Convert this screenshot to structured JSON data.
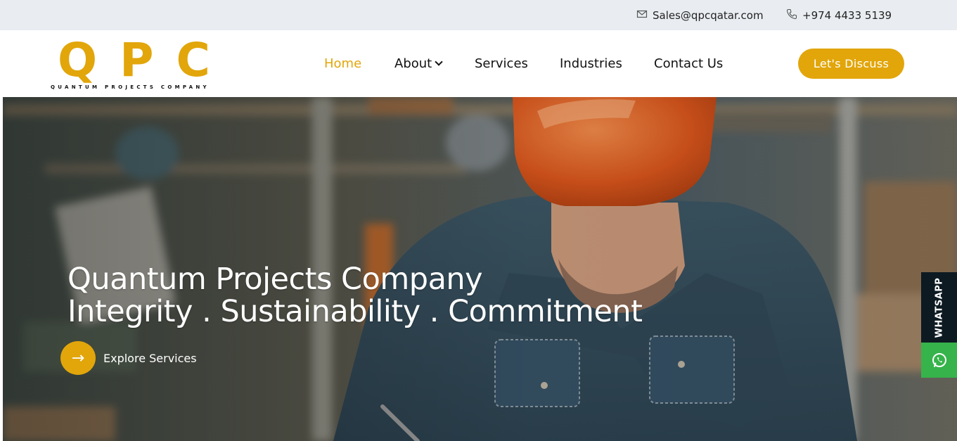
{
  "topbar": {
    "email": "Sales@qpcqatar.com",
    "phone": "+974 4433 5139",
    "email_icon": "envelope-icon",
    "phone_icon": "phone-icon"
  },
  "logo": {
    "letters": [
      "Q",
      "P",
      "C"
    ],
    "subtitle": "QUANTUM PROJECTS COMPANY"
  },
  "nav": {
    "items": [
      {
        "label": "Home",
        "active": true
      },
      {
        "label": "About",
        "has_dropdown": true
      },
      {
        "label": "Services"
      },
      {
        "label": "Industries"
      },
      {
        "label": "Contact Us"
      }
    ],
    "cta_label": "Let's Discuss"
  },
  "hero": {
    "title_line1": "Quantum Projects Company",
    "title_line2": "Integrity . Sustainability . Commitment",
    "explore_label": "Explore Services",
    "explore_icon": "arrow-right-icon"
  },
  "whatsapp": {
    "label": "WHATSAPP",
    "icon": "whatsapp-icon"
  },
  "colors": {
    "brand": "#e2a60b",
    "topbar_bg": "#e9edf1",
    "whatsapp_dark": "#0d1a22",
    "whatsapp_green": "#36b34a"
  }
}
